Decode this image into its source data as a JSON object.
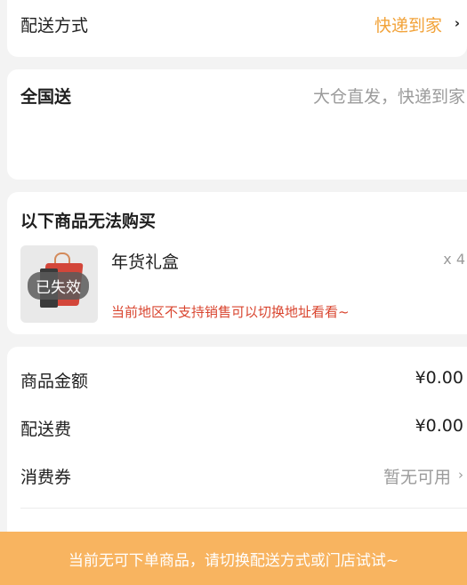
{
  "delivery": {
    "label": "配送方式",
    "value": "快递到家",
    "chevron": "›",
    "accent_color": "#f2a33a"
  },
  "shipping": {
    "label": "全国送",
    "description": "大仓直发，快递到家"
  },
  "unavailable": {
    "title": "以下商品无法购买",
    "items": [
      {
        "name": "年货礼盒",
        "quantity": "x 4",
        "badge": "已失效",
        "note": "当前地区不支持销售可以切换地址看看~",
        "thumbnail_icon": "gift-bag-icon"
      }
    ]
  },
  "summary": {
    "goods_amount_label": "商品金额",
    "goods_amount_value": "¥0.00",
    "shipping_fee_label": "配送费",
    "shipping_fee_value": "¥0.00",
    "coupon_label": "消费券",
    "coupon_value": "暂无可用",
    "coupon_chevron": "›"
  },
  "bottom_bar": {
    "message": "当前无可下单商品，请切换配送方式或门店试试~",
    "color": "#f8b460"
  }
}
